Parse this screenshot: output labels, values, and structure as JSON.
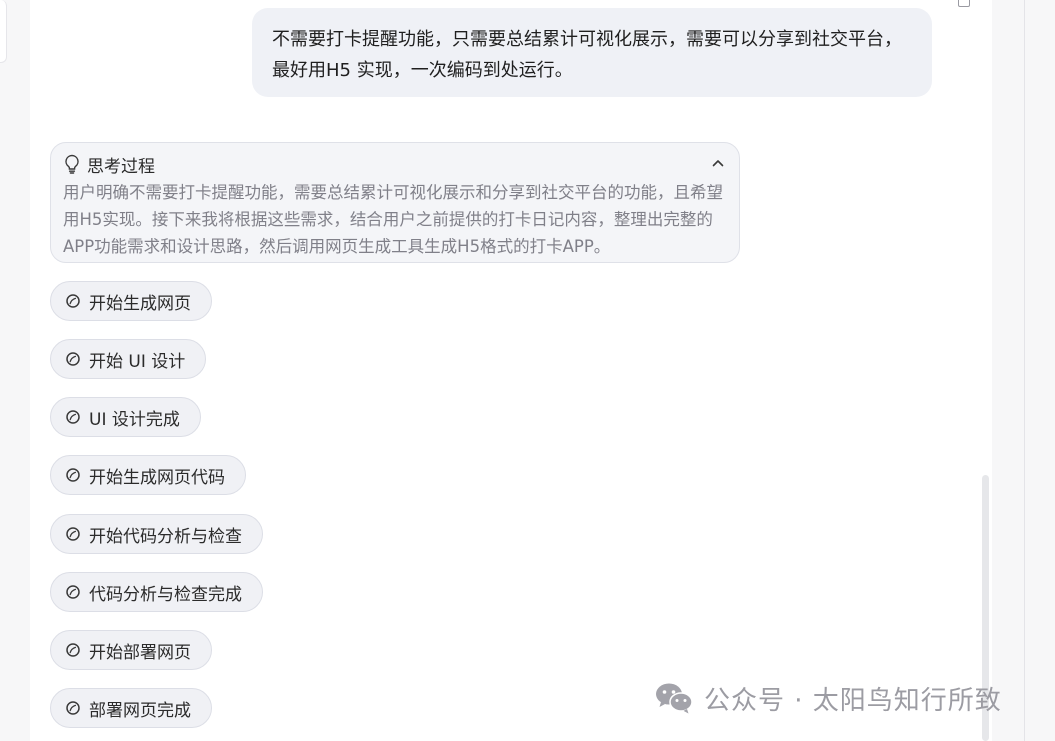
{
  "conversation": {
    "user_message": "不需要打卡提醒功能，只需要总结累计可视化展示，需要可以分享到社交平台，最好用H5 实现，一次编码到处运行。"
  },
  "thinking": {
    "title": "思考过程",
    "body": "用户明确不需要打卡提醒功能，需要总结累计可视化展示和分享到社交平台的功能，且希望用H5实现。接下来我将根据这些需求，结合用户之前提供的打卡日记内容，整理出完整的APP功能需求和设计思路，然后调用网页生成工具生成H5格式的打卡APP。",
    "icon": "lightbulb-icon",
    "collapse_icon": "chevron-up-icon"
  },
  "steps": [
    {
      "label": "开始生成网页"
    },
    {
      "label": "开始 UI 设计"
    },
    {
      "label": "UI 设计完成"
    },
    {
      "label": "开始生成网页代码"
    },
    {
      "label": "开始代码分析与检查"
    },
    {
      "label": "代码分析与检查完成"
    },
    {
      "label": "开始部署网页"
    },
    {
      "label": "部署网页完成"
    }
  ],
  "watermark": {
    "text": "公众号 · 太阳鸟知行所致",
    "icon": "wechat-icon"
  },
  "colors": {
    "user_bubble": "#eff1f6",
    "card_bg": "#f4f5f8",
    "muted_text": "#808089",
    "watermark": "#9c9ca3"
  }
}
